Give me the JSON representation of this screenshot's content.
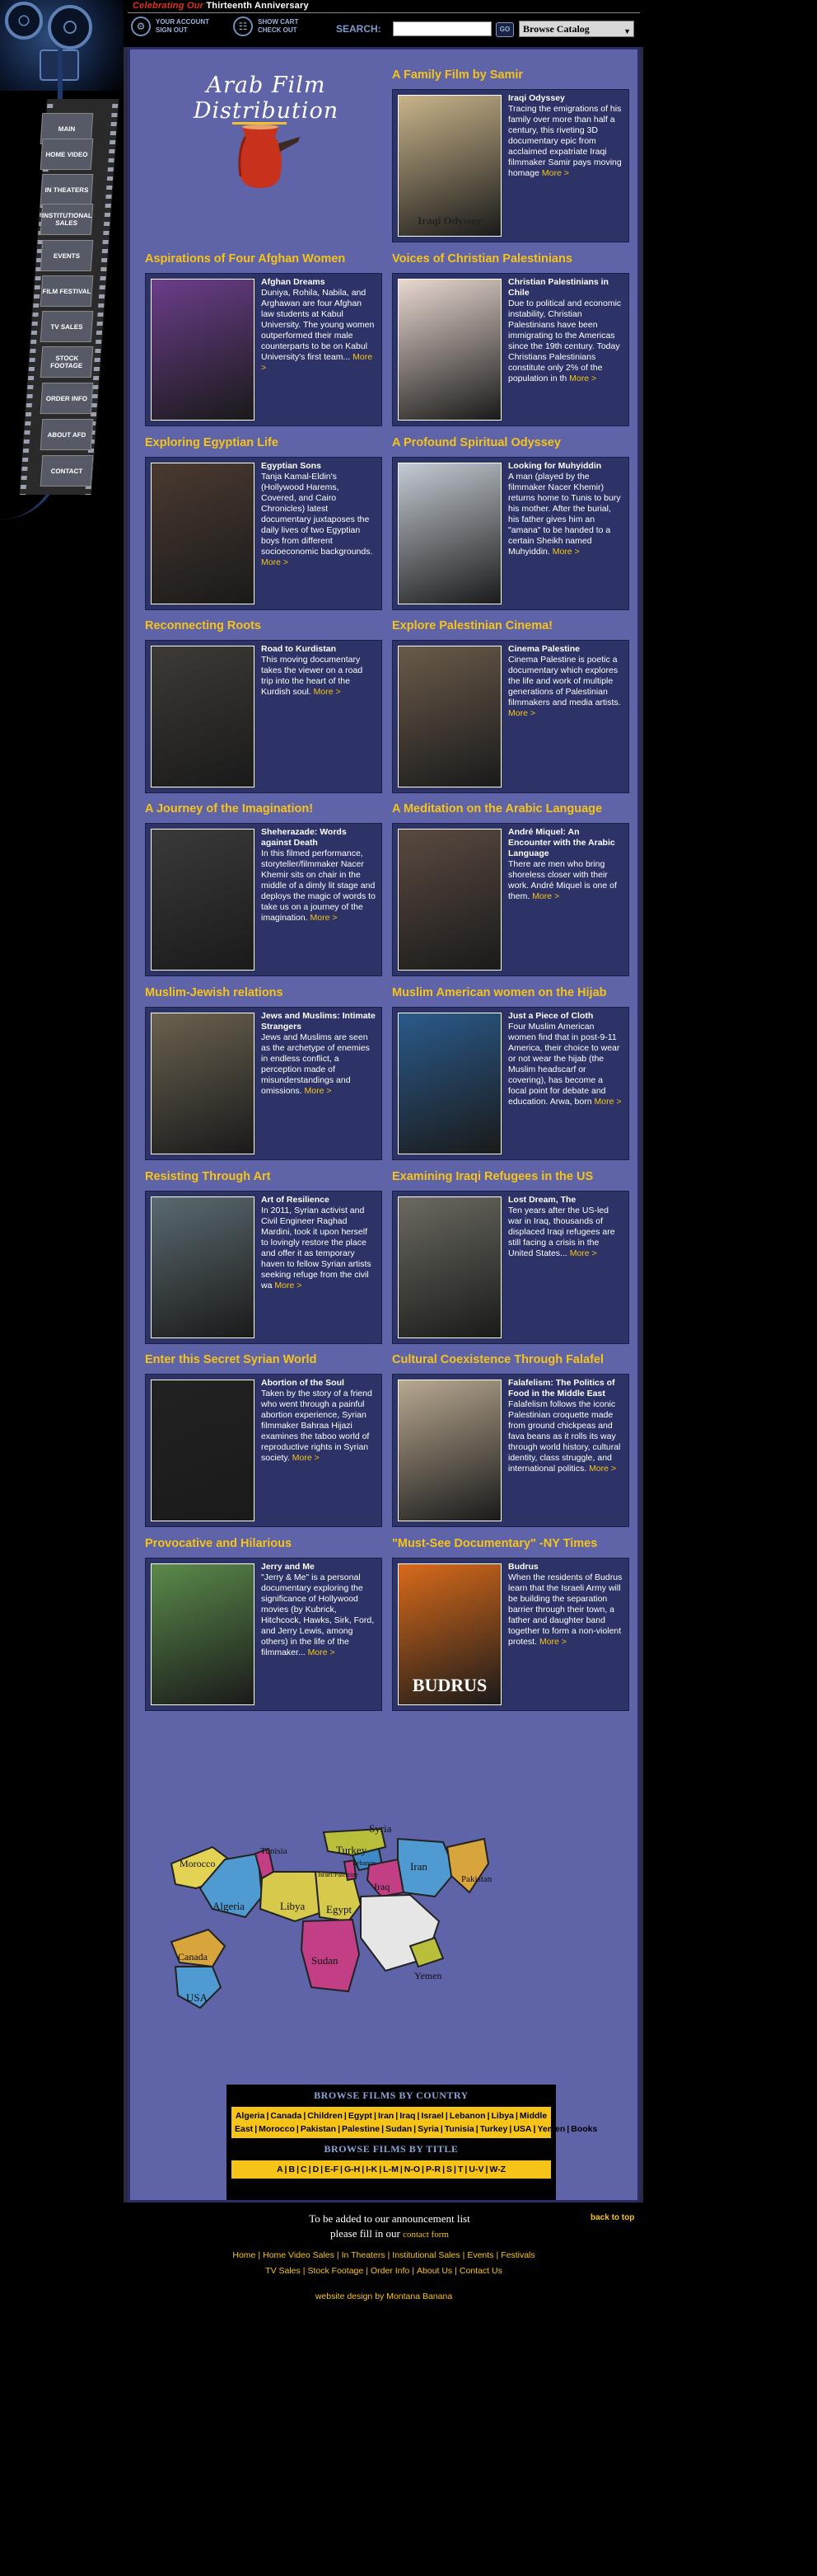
{
  "header": {
    "anniv_prefix": "Celebrating Our",
    "anniv_suffix": "Thirteenth Anniversary",
    "account_line1": "YOUR ACCOUNT",
    "account_line2": "SIGN OUT",
    "cart_line1": "SHOW CART",
    "cart_line2": "CHECK OUT",
    "search_label": "SEARCH:",
    "search_value": "",
    "go_label": "GO",
    "browse_selected": "Browse Catalog"
  },
  "nav": {
    "items": [
      "MAIN",
      "HOME VIDEO",
      "IN THEATERS",
      "INSTITUTIONAL SALES",
      "EVENTS",
      "FILM FESTIVAL",
      "TV SALES",
      "STOCK FOOTAGE",
      "ORDER INFO",
      "ABOUT AFD",
      "CONTACT"
    ]
  },
  "logo": {
    "text": "Arab Film Distribution"
  },
  "blocks": [
    {
      "title": "A Family Film by Samir",
      "name": "Iraqi Odyssey",
      "text": "Tracing the emigrations of his family over more than half a century, this riveting 3D documentary epic from acclaimed expatriate Iraqi filmmaker Samir pays moving homage",
      "more": "More >",
      "poster": "Iraqi Odyssey",
      "color": "#c9b48a"
    },
    {
      "title": "Aspirations of Four Afghan Women",
      "name": "Afghan Dreams",
      "text": "Duniya, Rohila, Nabila, and Arghawan are four Afghan law students at Kabul University. The young women outperformed their male counterparts to be on Kabul University's first team...",
      "more": "More >",
      "poster": "",
      "color": "#6b3d8a"
    },
    {
      "title": "Voices of Christian Palestinians",
      "name": "Christian Palestinians in Chile",
      "text": "Due to political and economic instability, Christian Palestinians have been immigrating to the Americas since the 19th century. Today Christians Palestinians constitute only 2% of the population in th",
      "more": "More >",
      "poster": "",
      "color": "#e8d8d0"
    },
    {
      "title": "Exploring Egyptian Life",
      "name": "Egyptian Sons",
      "text": "Tanja Kamal-Eldin's (Hollywood Harems, Covered, and Cairo Chronicles) latest documentary juxtaposes the daily lives of two Egyptian boys from different socioeconomic backgrounds.",
      "more": "More >",
      "poster": "",
      "color": "#4a3a30"
    },
    {
      "title": "A Profound Spiritual Odyssey",
      "name": "Looking for Muhyiddin",
      "text": "A man (played by the filmmaker Nacer Khemir) returns home to Tunis to bury his mother. After the burial, his father gives him an \"amana\" to be handed to a certain Sheikh named Muhyiddin.",
      "more": "More >",
      "poster": "",
      "color": "#c4cbd3"
    },
    {
      "title": "Reconnecting Roots",
      "name": "Road to Kurdistan",
      "text": "This moving documentary takes the viewer on a road trip into the heart of the Kurdish soul.",
      "more": "More >",
      "poster": "",
      "color": "#3d3a36"
    },
    {
      "title": "Explore Palestinian Cinema!",
      "name": "Cinema Palestine",
      "text": "Cinema Palestine is poetic a documentary which explores the life and work of multiple generations of Palestinian filmmakers and media artists.",
      "more": "More >",
      "poster": "",
      "color": "#6a5a4a"
    },
    {
      "title": "A Journey of the Imagination!",
      "name": "Sheherazade: Words against Death",
      "text": "In this filmed performance, storyteller/filmmaker Nacer Khemir sits on chair in the middle of a dimly lit stage and deploys the magic of words to take us on a journey of the imagination.",
      "more": "More >",
      "poster": "",
      "color": "#3a3a3a"
    },
    {
      "title": "A Meditation on the Arabic Language",
      "name": "André Miquel: An Encounter with the Arabic Language",
      "text": "There are men who bring shoreless closer with their work. André Miquel is one of them.",
      "more": "More >",
      "poster": "",
      "color": "#5a4a40"
    },
    {
      "title": "Muslim-Jewish relations",
      "name": "Jews and Muslims: Intimate Strangers",
      "text": "Jews and Muslims are seen as the archetype of enemies in endless conflict, a perception made of misunderstandings and omissions.",
      "more": "More >",
      "poster": "",
      "color": "#6a6250"
    },
    {
      "title": "Muslim American women on the Hijab",
      "name": "Just a Piece of Cloth",
      "text": "Four Muslim American women find that in post-9-11 America, their choice to wear or not wear the hijab (the Muslim headscarf or covering), has become a focal point for debate and education. Arwa, born",
      "more": "More >",
      "poster": "",
      "color": "#2a5a8a"
    },
    {
      "title": "Resisting Through Art",
      "name": "Art of Resilience",
      "text": "In 2011, Syrian activist and Civil Engineer Raghad Mardini, took it upon herself to lovingly restore the place and offer it as temporary haven to fellow Syrian artists seeking refuge from the civil wa",
      "more": "More >",
      "poster": "",
      "color": "#5a6a70"
    },
    {
      "title": "Examining Iraqi Refugees in the US",
      "name": "Lost Dream, The",
      "text": "Ten years after the US-led war in Iraq, thousands of displaced Iraqi refugees are still facing a crisis in the United States...",
      "more": "More >",
      "poster": "",
      "color": "#6a6a60"
    },
    {
      "title": "Enter this Secret Syrian World",
      "name": "Abortion of the Soul",
      "text": "Taken by the story of a friend who went through a painful abortion experience, Syrian filmmaker Bahraa Hijazi examines the taboo world of reproductive rights in Syrian society.",
      "more": "More >",
      "poster": "",
      "color": "#222222"
    },
    {
      "title": "Cultural Coexistence Through Falafel",
      "name": "Falafelism: The Politics of Food in the Middle East",
      "text": "Falafelism follows the iconic Palestinian croquette made from ground chickpeas and fava beans as it rolls its way through world history, cultural identity, class struggle, and international politics.",
      "more": "More >",
      "poster": "",
      "color": "#b8a890"
    },
    {
      "title": "Provocative and Hilarious",
      "name": "Jerry and Me",
      "text": "\"Jerry & Me\" is a personal documentary exploring the significance of Hollywood movies (by Kubrick, Hitchcock, Hawks, Sirk, Ford, and Jerry Lewis, among others) in the life of the filmmaker...",
      "more": "More >",
      "poster": "",
      "color": "#5a8a4a"
    },
    {
      "title": "\"Must-See Documentary\" -NY Times",
      "name": "Budrus",
      "text": "When the residents of Budrus learn that the Israeli Army will be building the separation barrier through their town, a father and daughter band together to form a non-violent protest.",
      "more": "More >",
      "poster": "BUDRUS",
      "color": "#d86a1a"
    }
  ],
  "map": {
    "labels": [
      "Syria",
      "Morocco",
      "Tunisia",
      "Turkey",
      "Iran",
      "Israel/Palestine",
      "Iraq",
      "Algeria",
      "Libya",
      "Egypt",
      "Lebanon",
      "Pakistan",
      "Canada",
      "Sudan",
      "Yemen",
      "USA"
    ]
  },
  "browse": {
    "country_head": "BROWSE FILMS BY COUNTRY",
    "countries": [
      "Algeria",
      "Canada",
      "Children",
      "Egypt",
      "Iran",
      "Iraq",
      "Israel",
      "Lebanon",
      "Libya",
      "Middle East",
      "Morocco",
      "Pakistan",
      "Palestine",
      "Sudan",
      "Syria",
      "Tunisia",
      "Turkey",
      "USA",
      "Yemen",
      "Books"
    ],
    "title_head": "BROWSE FILMS BY TITLE",
    "titles": [
      "A",
      "B",
      "C",
      "D",
      "E-F",
      "G-H",
      "I-K",
      "L-M",
      "N-O",
      "P-R",
      "S",
      "T",
      "U-V",
      "W-Z"
    ]
  },
  "announce": {
    "line1": "To be added to our announcement list",
    "line2_pre": "please fill in our",
    "link": "contact form"
  },
  "footer": {
    "back_top": "back to top",
    "links_row1": [
      "Home",
      "Home Video Sales",
      "In Theaters",
      "Institutional Sales",
      "Events",
      "Festivals"
    ],
    "links_row2": [
      "TV Sales",
      "Stock Footage",
      "Order Info",
      "About Us",
      "Contact Us"
    ],
    "credit": "website design by Montana Banana"
  },
  "colors": {
    "panel": "#5f63a8",
    "accent": "#f6c418",
    "card": "#2d3367"
  }
}
